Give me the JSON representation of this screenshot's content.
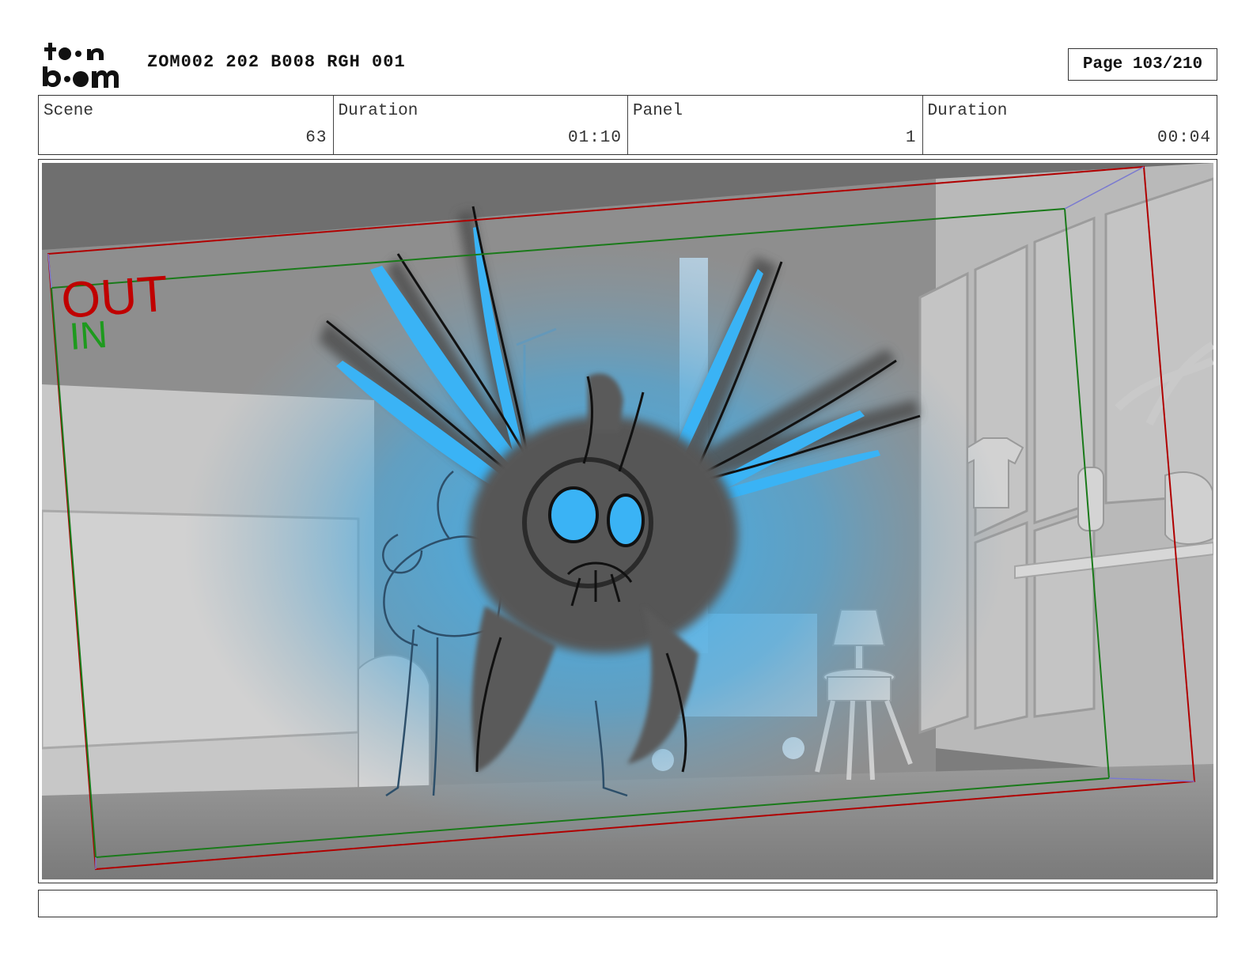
{
  "header": {
    "logo_text": "toon boom",
    "doc_title": "ZOM002 202 B008 RGH 001",
    "page_label": "Page 103/210"
  },
  "info": {
    "scene_label": "Scene",
    "scene_value": "63",
    "scene_duration_label": "Duration",
    "scene_duration_value": "01:10",
    "panel_label": "Panel",
    "panel_value": "1",
    "panel_duration_label": "Duration",
    "panel_duration_value": "00:04"
  },
  "panel": {
    "out_label": "OUT",
    "in_label": "IN",
    "out_color": "#c00000",
    "in_color": "#1e9a1e",
    "glow_color": "#3ab3f5"
  },
  "caption": {
    "text": ""
  }
}
